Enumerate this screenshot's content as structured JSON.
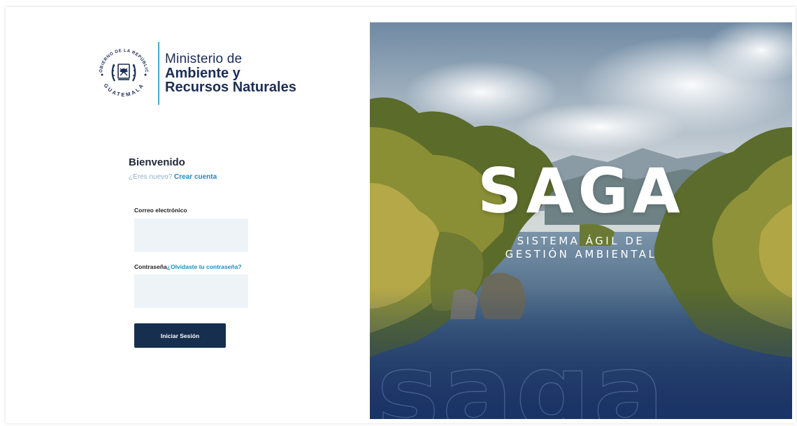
{
  "logo": {
    "seal_top_text": "GOBIERNO DE LA REPÚBLICA",
    "seal_bottom_text": "GUATEMALA",
    "line1": "Ministerio de",
    "line2": "Ambiente y",
    "line3": "Recursos Naturales"
  },
  "form": {
    "title": "Bienvenido",
    "signup_prompt": "¿Eres nuevo?",
    "signup_link": "Crear cuenta",
    "email_label": "Correo electrónico",
    "email_value": "",
    "password_label": "Contraseña",
    "forgot_link": "¿Olvidaste tu contraseña?",
    "password_value": "",
    "submit_label": "Iniciar Sesión"
  },
  "hero": {
    "title": "SAGA",
    "subtitle_line1": "SISTEMA ÁGIL DE",
    "subtitle_line2": "GESTIÓN AMBIENTAL",
    "watermark": "saga"
  },
  "colors": {
    "navy": "#172f4f",
    "link": "#1e8bbf",
    "input_bg": "#eef3f7",
    "accent_line": "#4aa8c9"
  }
}
